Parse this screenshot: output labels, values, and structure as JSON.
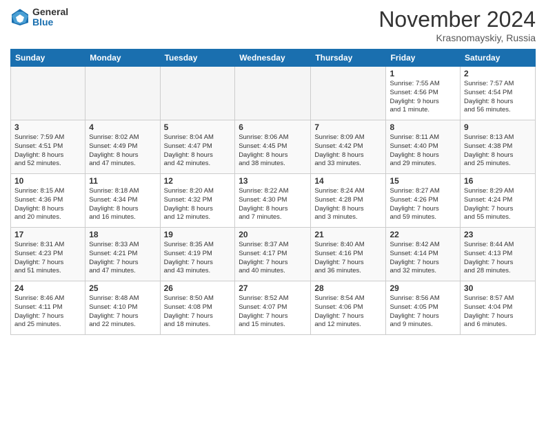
{
  "logo": {
    "general": "General",
    "blue": "Blue"
  },
  "title": "November 2024",
  "location": "Krasnomayskiy, Russia",
  "days_header": [
    "Sunday",
    "Monday",
    "Tuesday",
    "Wednesday",
    "Thursday",
    "Friday",
    "Saturday"
  ],
  "weeks": [
    [
      {
        "num": "",
        "info": ""
      },
      {
        "num": "",
        "info": ""
      },
      {
        "num": "",
        "info": ""
      },
      {
        "num": "",
        "info": ""
      },
      {
        "num": "",
        "info": ""
      },
      {
        "num": "1",
        "info": "Sunrise: 7:55 AM\nSunset: 4:56 PM\nDaylight: 9 hours\nand 1 minute."
      },
      {
        "num": "2",
        "info": "Sunrise: 7:57 AM\nSunset: 4:54 PM\nDaylight: 8 hours\nand 56 minutes."
      }
    ],
    [
      {
        "num": "3",
        "info": "Sunrise: 7:59 AM\nSunset: 4:51 PM\nDaylight: 8 hours\nand 52 minutes."
      },
      {
        "num": "4",
        "info": "Sunrise: 8:02 AM\nSunset: 4:49 PM\nDaylight: 8 hours\nand 47 minutes."
      },
      {
        "num": "5",
        "info": "Sunrise: 8:04 AM\nSunset: 4:47 PM\nDaylight: 8 hours\nand 42 minutes."
      },
      {
        "num": "6",
        "info": "Sunrise: 8:06 AM\nSunset: 4:45 PM\nDaylight: 8 hours\nand 38 minutes."
      },
      {
        "num": "7",
        "info": "Sunrise: 8:09 AM\nSunset: 4:42 PM\nDaylight: 8 hours\nand 33 minutes."
      },
      {
        "num": "8",
        "info": "Sunrise: 8:11 AM\nSunset: 4:40 PM\nDaylight: 8 hours\nand 29 minutes."
      },
      {
        "num": "9",
        "info": "Sunrise: 8:13 AM\nSunset: 4:38 PM\nDaylight: 8 hours\nand 25 minutes."
      }
    ],
    [
      {
        "num": "10",
        "info": "Sunrise: 8:15 AM\nSunset: 4:36 PM\nDaylight: 8 hours\nand 20 minutes."
      },
      {
        "num": "11",
        "info": "Sunrise: 8:18 AM\nSunset: 4:34 PM\nDaylight: 8 hours\nand 16 minutes."
      },
      {
        "num": "12",
        "info": "Sunrise: 8:20 AM\nSunset: 4:32 PM\nDaylight: 8 hours\nand 12 minutes."
      },
      {
        "num": "13",
        "info": "Sunrise: 8:22 AM\nSunset: 4:30 PM\nDaylight: 8 hours\nand 7 minutes."
      },
      {
        "num": "14",
        "info": "Sunrise: 8:24 AM\nSunset: 4:28 PM\nDaylight: 8 hours\nand 3 minutes."
      },
      {
        "num": "15",
        "info": "Sunrise: 8:27 AM\nSunset: 4:26 PM\nDaylight: 7 hours\nand 59 minutes."
      },
      {
        "num": "16",
        "info": "Sunrise: 8:29 AM\nSunset: 4:24 PM\nDaylight: 7 hours\nand 55 minutes."
      }
    ],
    [
      {
        "num": "17",
        "info": "Sunrise: 8:31 AM\nSunset: 4:23 PM\nDaylight: 7 hours\nand 51 minutes."
      },
      {
        "num": "18",
        "info": "Sunrise: 8:33 AM\nSunset: 4:21 PM\nDaylight: 7 hours\nand 47 minutes."
      },
      {
        "num": "19",
        "info": "Sunrise: 8:35 AM\nSunset: 4:19 PM\nDaylight: 7 hours\nand 43 minutes."
      },
      {
        "num": "20",
        "info": "Sunrise: 8:37 AM\nSunset: 4:17 PM\nDaylight: 7 hours\nand 40 minutes."
      },
      {
        "num": "21",
        "info": "Sunrise: 8:40 AM\nSunset: 4:16 PM\nDaylight: 7 hours\nand 36 minutes."
      },
      {
        "num": "22",
        "info": "Sunrise: 8:42 AM\nSunset: 4:14 PM\nDaylight: 7 hours\nand 32 minutes."
      },
      {
        "num": "23",
        "info": "Sunrise: 8:44 AM\nSunset: 4:13 PM\nDaylight: 7 hours\nand 28 minutes."
      }
    ],
    [
      {
        "num": "24",
        "info": "Sunrise: 8:46 AM\nSunset: 4:11 PM\nDaylight: 7 hours\nand 25 minutes."
      },
      {
        "num": "25",
        "info": "Sunrise: 8:48 AM\nSunset: 4:10 PM\nDaylight: 7 hours\nand 22 minutes."
      },
      {
        "num": "26",
        "info": "Sunrise: 8:50 AM\nSunset: 4:08 PM\nDaylight: 7 hours\nand 18 minutes."
      },
      {
        "num": "27",
        "info": "Sunrise: 8:52 AM\nSunset: 4:07 PM\nDaylight: 7 hours\nand 15 minutes."
      },
      {
        "num": "28",
        "info": "Sunrise: 8:54 AM\nSunset: 4:06 PM\nDaylight: 7 hours\nand 12 minutes."
      },
      {
        "num": "29",
        "info": "Sunrise: 8:56 AM\nSunset: 4:05 PM\nDaylight: 7 hours\nand 9 minutes."
      },
      {
        "num": "30",
        "info": "Sunrise: 8:57 AM\nSunset: 4:04 PM\nDaylight: 7 hours\nand 6 minutes."
      }
    ]
  ]
}
